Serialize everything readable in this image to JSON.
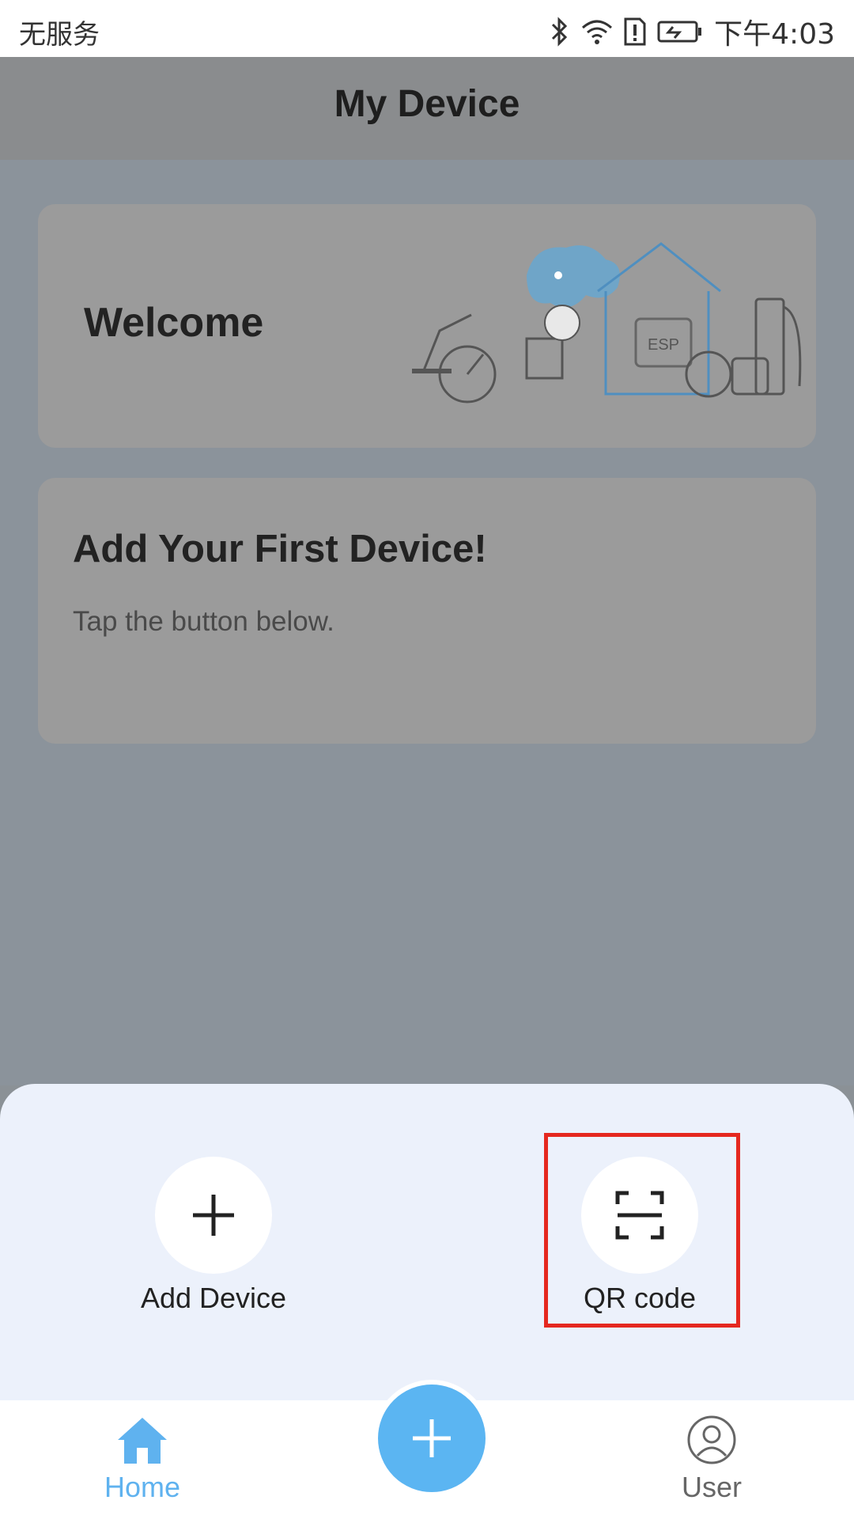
{
  "status_bar": {
    "carrier": "无服务",
    "time": "下午4:03",
    "icons": [
      "bluetooth-icon",
      "wifi-icon",
      "alert-sim-icon",
      "battery-icon"
    ]
  },
  "header": {
    "title": "My Device"
  },
  "welcome_card": {
    "label": "Welcome",
    "illustration_text": "ESP"
  },
  "add_card": {
    "heading": "Add Your First Device!",
    "subtext": "Tap the button below."
  },
  "bottom_sheet": {
    "actions": [
      {
        "label": "Add Device",
        "icon": "plus-icon"
      },
      {
        "label": "QR code",
        "icon": "scan-icon",
        "highlighted": true
      }
    ]
  },
  "bottom_nav": {
    "items": [
      {
        "label": "Home",
        "icon": "home-icon",
        "active": true
      },
      {
        "label": "User",
        "icon": "user-icon",
        "active": false
      }
    ],
    "fab_icon": "plus-icon"
  },
  "colors": {
    "accent": "#5bb5f2",
    "highlight": "#e5281f",
    "sheet": "#ecf1fb"
  }
}
